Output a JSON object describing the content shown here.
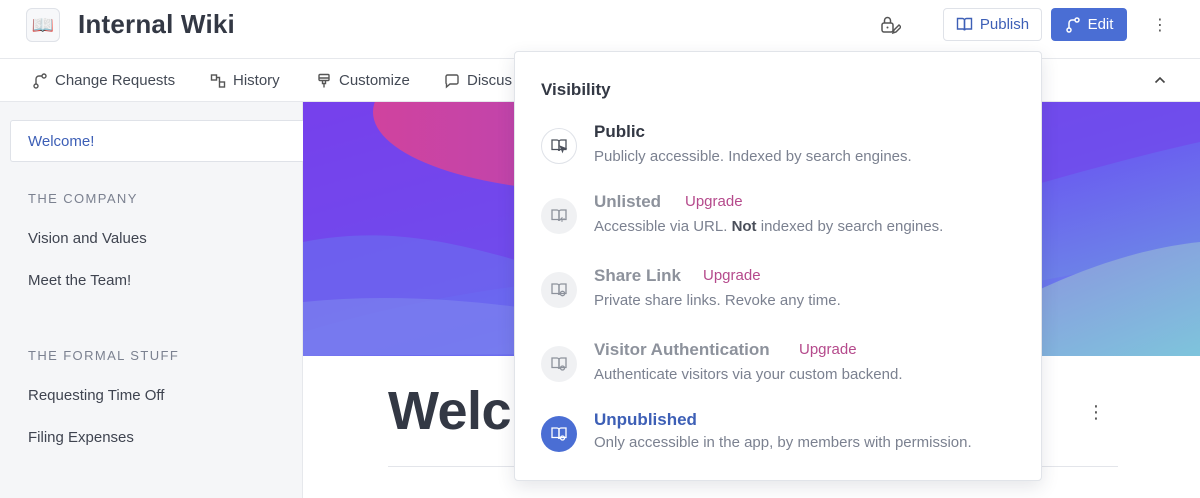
{
  "header": {
    "logo_glyph": "📖",
    "title": "Internal Wiki",
    "publish_label": "Publish",
    "edit_label": "Edit",
    "more_glyph": "⋮"
  },
  "tabs": [
    {
      "label": "Change Requests",
      "icon": "branch-icon"
    },
    {
      "label": "History",
      "icon": "history-icon"
    },
    {
      "label": "Customize",
      "icon": "brush-icon"
    },
    {
      "label": "Discus",
      "icon": "chat-icon"
    }
  ],
  "sidebar": {
    "active": "Welcome!",
    "sections": [
      {
        "heading": "THE COMPANY",
        "items": [
          "Vision and Values",
          "Meet the Team!"
        ]
      },
      {
        "heading": "THE FORMAL STUFF",
        "items": [
          "Requesting Time Off",
          "Filing Expenses"
        ]
      }
    ]
  },
  "main": {
    "title": "Welc",
    "more_glyph": "⋮"
  },
  "visibility": {
    "title": "Visibility",
    "upgrade_label": "Upgrade",
    "options": [
      {
        "name": "Public",
        "desc": "Publicly accessible. Indexed by search engines.",
        "upgrade": false,
        "state": "default"
      },
      {
        "name": "Unlisted",
        "desc_pre": "Accessible via URL. ",
        "desc_bold": "Not",
        "desc_post": " indexed by search engines.",
        "upgrade": true,
        "state": "dim"
      },
      {
        "name": "Share Link",
        "desc": "Private share links. Revoke any time.",
        "upgrade": true,
        "state": "dim"
      },
      {
        "name": "Visitor Authentication",
        "desc": "Authenticate visitors via your custom backend.",
        "upgrade": true,
        "state": "dim"
      },
      {
        "name": "Unpublished",
        "desc": "Only accessible in the app, by members with permission.",
        "upgrade": false,
        "state": "selected"
      }
    ]
  },
  "colors": {
    "accent": "#4a6ed4",
    "link": "#3d5fb6",
    "upgrade": "#b54a8c"
  }
}
